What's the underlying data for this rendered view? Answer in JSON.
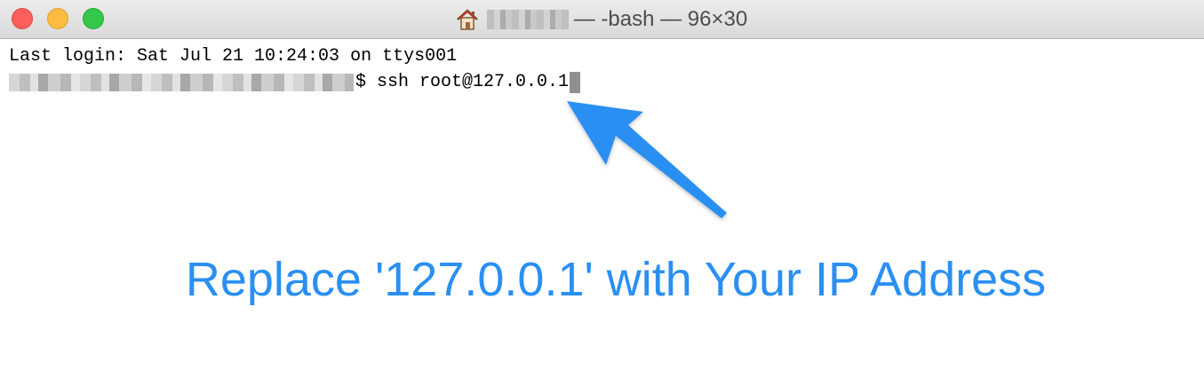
{
  "window": {
    "title_suffix": "— -bash — 96×30",
    "user_redacted": true
  },
  "icons": {
    "title_icon": "home-icon",
    "traffic_lights": [
      "close-button",
      "minimize-button",
      "zoom-button"
    ]
  },
  "colors": {
    "close": "#fc605c",
    "minimize": "#fdbc40",
    "zoom": "#34c84a",
    "annotation": "#2a8ff2",
    "cursor": "#8f8f8f"
  },
  "terminal": {
    "last_login": "Last login: Sat Jul 21 10:24:03 on ttys001",
    "prompt_suffix": "$ ",
    "command": "ssh root@127.0.0.1"
  },
  "annotation": {
    "text": "Replace '127.0.0.1' with Your IP Address"
  }
}
